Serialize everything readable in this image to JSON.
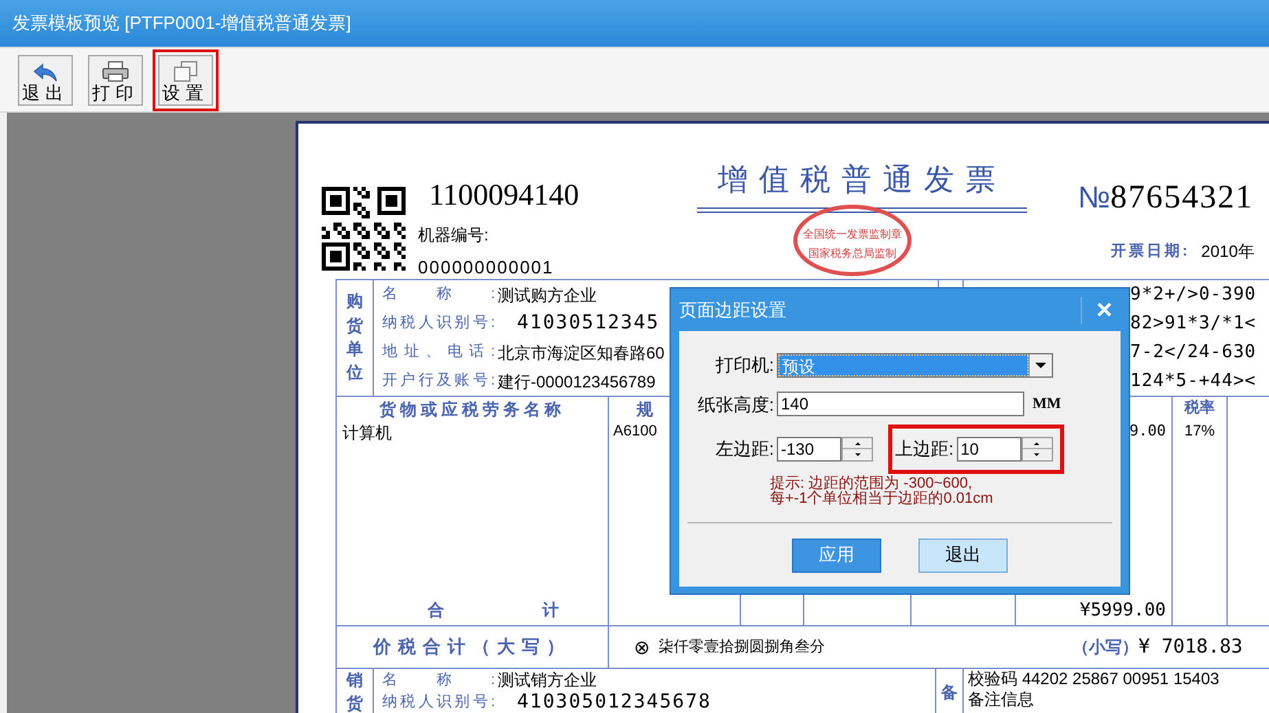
{
  "window": {
    "title": "发票模板预览 [PTFP0001-增值税普通发票]"
  },
  "toolbar": [
    {
      "label": "退出",
      "highlighted": false
    },
    {
      "label": "打印",
      "highlighted": false
    },
    {
      "label": "设置",
      "highlighted": true
    }
  ],
  "invoice": {
    "code": "1100094140",
    "machine_label": "机器编号:",
    "machine_number": "000000000001",
    "title": "增值税普通发票",
    "stamp_top": "全国统一发票监制章",
    "stamp_bottom": "国家税务总局监制",
    "number_mark": "№",
    "number": "87654321",
    "date_label": "开票日期:",
    "date": "2010年",
    "buyer": {
      "side": "购货单位",
      "rows": [
        {
          "label": "名称:",
          "value": "测试购方企业",
          "kind": "text"
        },
        {
          "label": "纳税人识别号:",
          "value": "41030512345",
          "kind": "number"
        },
        {
          "label": "地址、电话:",
          "value": "北京市海淀区知春路60",
          "kind": "text"
        },
        {
          "label": "开户行及账号:",
          "value": "建行-0000123456789",
          "kind": "text"
        }
      ],
      "cipher": [
        "9*2+/>0-390",
        "82>91*3/*1<",
        "7-2</24-630",
        "124*5-+44><"
      ]
    },
    "goods": {
      "header_name": "货物或应税劳务名称",
      "header_spec": "规",
      "header_rate": "税率",
      "row": {
        "name": "计算机",
        "spec": "A6100",
        "amount": "9.00",
        "rate": "17%"
      },
      "total_label": [
        "合",
        "计"
      ],
      "total_amount": "¥5999.00"
    },
    "tax_total": {
      "label": "价税合计（大写）",
      "symbol": "⊗",
      "words": "柒仟零壹拾捌圆捌角叁分",
      "small_label": "（小写）",
      "small_amount": "¥ 7018.83"
    },
    "seller": {
      "side": "销货",
      "rows": [
        {
          "label": "名称:",
          "value": "测试销方企业",
          "kind": "text"
        },
        {
          "label": "纳税人识别号:",
          "value": "410305012345678",
          "kind": "number"
        }
      ],
      "remark_side": "备",
      "remarks": [
        "校验码 44202 25867 00951 15403",
        "备注信息"
      ]
    }
  },
  "dialog": {
    "title": "页面边距设置",
    "close": "×",
    "printer": {
      "label": "打印机:",
      "value": "预设",
      "kind": "select",
      "selected": true
    },
    "paper_height": {
      "label": "纸张高度:",
      "value": "140",
      "kind": "text",
      "unit": "MM"
    },
    "left_margin": {
      "label": "左边距:",
      "value": "-130",
      "kind": "spinner",
      "highlighted": false
    },
    "top_margin": {
      "label": "上边距:",
      "value": "10",
      "kind": "spinner",
      "highlighted": true
    },
    "hint": [
      "提示: 边距的范围为 -300~600,",
      "每+-1个单位相当于边距的0.01cm"
    ],
    "buttons": [
      {
        "label": "应用",
        "primary": true
      },
      {
        "label": "退出",
        "primary": false
      }
    ]
  }
}
